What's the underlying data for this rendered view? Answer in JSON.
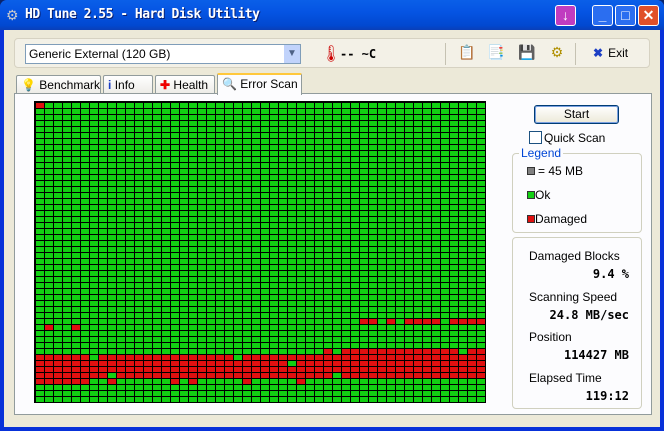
{
  "window": {
    "title": "HD Tune 2.55 - Hard Disk Utility"
  },
  "toolbar": {
    "drive": "Generic External (120 GB)",
    "temperature": "-- ~C",
    "exit_label": "Exit"
  },
  "tabs": [
    {
      "label": "Benchmark"
    },
    {
      "label": "Info"
    },
    {
      "label": "Health"
    },
    {
      "label": "Error Scan"
    }
  ],
  "scan": {
    "start_label": "Start",
    "quick_scan_label": "Quick Scan",
    "quick_scan_checked": false,
    "legend": {
      "title": "Legend",
      "block_size": "= 45 MB",
      "ok": "Ok",
      "damaged": "Damaged"
    },
    "stats": {
      "damaged_blocks_label": "Damaged Blocks",
      "damaged_blocks": "9.4 %",
      "speed_label": "Scanning Speed",
      "speed": "24.8 MB/sec",
      "position_label": "Position",
      "position": "114427 MB",
      "elapsed_label": "Elapsed Time",
      "elapsed": "119:12"
    }
  },
  "block_map": {
    "rows": 50,
    "cols": 50,
    "colors": {
      "ok": "#12d012",
      "damaged": "#e01010",
      "unit": "#808080"
    },
    "damaged": {
      "0": [
        0
      ],
      "36": [
        36,
        37,
        39,
        41,
        42,
        43,
        44,
        46,
        47,
        48,
        49
      ],
      "37": [
        1,
        4
      ],
      "41": [
        32,
        34,
        35,
        36,
        37,
        38,
        39,
        40,
        41,
        42,
        43,
        44,
        45,
        46,
        48,
        49
      ],
      "42": "all_except:6,22",
      "43": "all_except:28",
      "44": "all",
      "45": "all_except:8,33",
      "46": [
        0,
        1,
        2,
        3,
        4,
        5,
        8,
        15,
        17,
        23,
        29
      ]
    }
  }
}
